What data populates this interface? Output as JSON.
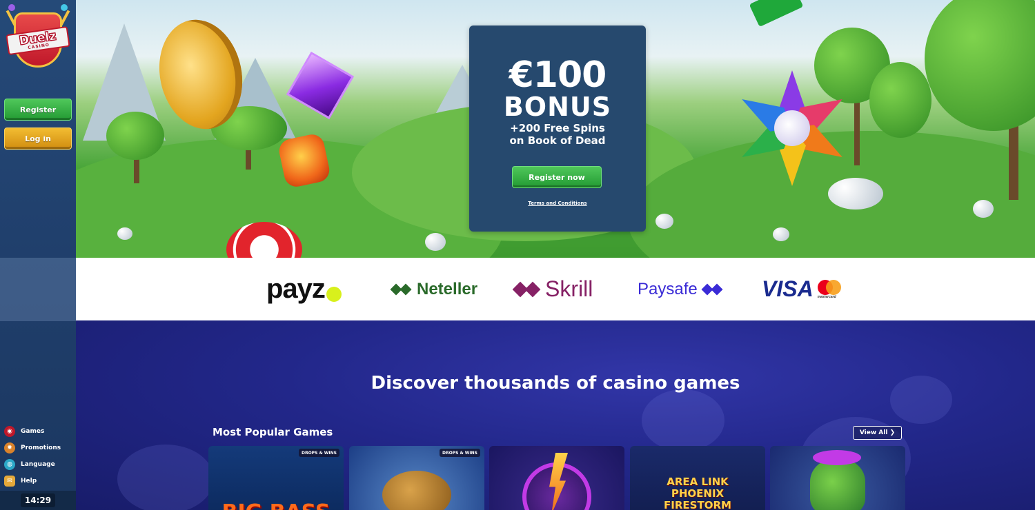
{
  "sidebar": {
    "logo": {
      "name": "Duelz",
      "tagline": "CASINO"
    },
    "register_label": "Register",
    "login_label": "Log in",
    "nav": [
      {
        "label": "Games",
        "icon": "games-icon"
      },
      {
        "label": "Promotions",
        "icon": "promotions-icon"
      },
      {
        "label": "Language",
        "icon": "language-icon"
      },
      {
        "label": "Help",
        "icon": "help-icon"
      }
    ],
    "clock": "14:29"
  },
  "hero": {
    "amount": "€100",
    "bonus": "BONUS",
    "line1": "+200 Free Spins",
    "line2": "on Book of Dead",
    "cta": "Register now",
    "terms": "Terms and Conditions"
  },
  "payments": {
    "payz": "payz",
    "neteller": "Neteller",
    "skrill": "Skrill",
    "paysafe": "Paysafe",
    "visa": "VISA",
    "mastercard": "mastercard"
  },
  "games": {
    "heading": "Discover thousands of casino games",
    "section_title": "Most Popular Games",
    "view_all": "View All ❯",
    "cards": [
      {
        "badge": "DROPS & WINS",
        "art": "BIG BASS"
      },
      {
        "badge": "DROPS & WINS",
        "art": ""
      },
      {
        "badge": "",
        "art": ""
      },
      {
        "badge": "",
        "art": "AREA LINK PHOENIX FIRESTORM"
      },
      {
        "badge": "",
        "art": ""
      }
    ]
  },
  "colors": {
    "sidebar": "#214470",
    "register_green": "#2fab3e",
    "login_gold": "#e3a21f",
    "bonus_card": "#26496e",
    "games_bg": "#22278a"
  }
}
